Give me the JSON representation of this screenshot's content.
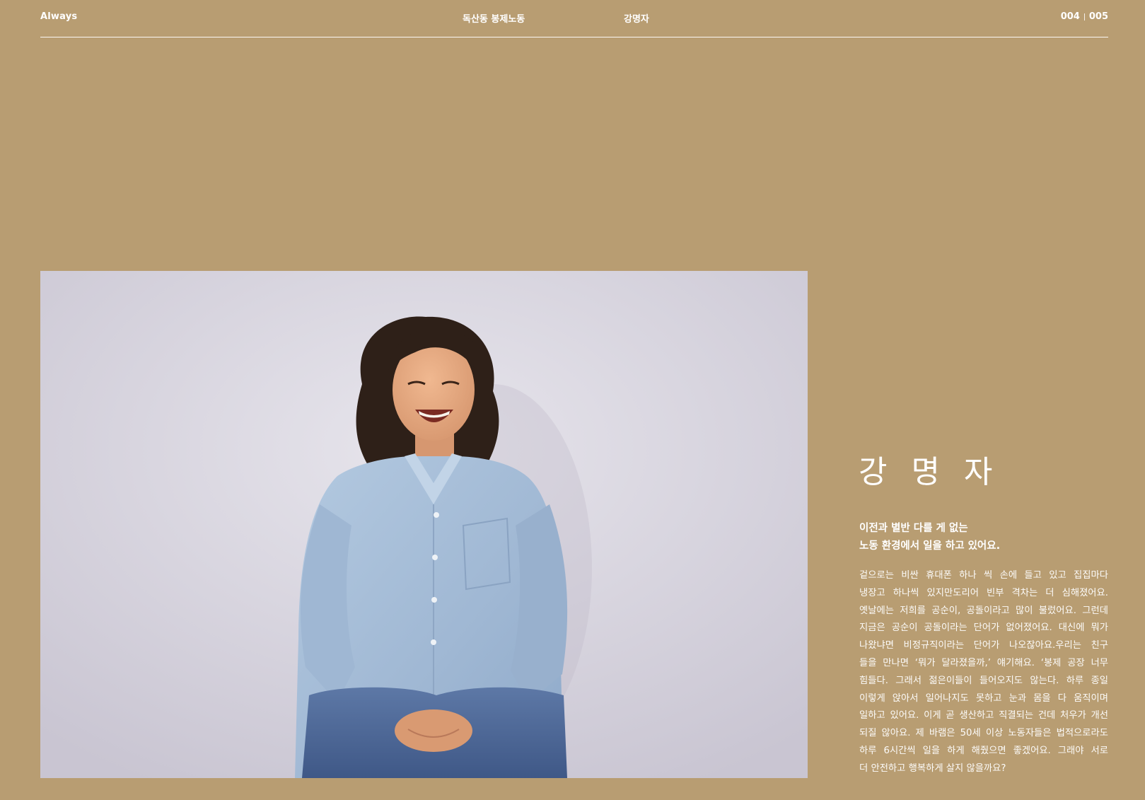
{
  "header": {
    "brand": "Always",
    "section": "독산동 봉제노동",
    "person": "강명자",
    "page_current": "004",
    "page_total": "005"
  },
  "photo": {
    "subject": "강명자 portrait"
  },
  "profile": {
    "name": "강 명 자",
    "lead_lines": [
      "이전과 별반 다를 게 없는",
      "노동 환경에서 일을 하고 있어요."
    ],
    "body_lines": [
      "겉으로는 비싼 휴대폰 하나 씩 손에 들고 있고 집집마다",
      "냉장고 하나씩 있지만도리어 빈부 격차는 더 심해졌어요.",
      "옛날에는 저희를 공순이, 공돌이라고 많이 불렀어요. 그런데",
      "지금은 공순이 공돌이라는 단어가 없어졌어요. 대신에 뭐가",
      "나왔냐면 비정규직이라는 단어가 나오잖아요.우리는 친구",
      "들을 만나면 ‘뭐가 달라졌을까,’ 얘기해요. ‘봉제 공장 너무",
      "힘들다. 그래서 젊은이들이 들어오지도 않는다. 하루 종일",
      "이렇게 앉아서 일어나지도 못하고 눈과 몸을 다 움직이며",
      "일하고 있어요. 이게 곧 생산하고 직결되는 건데 처우가 개선",
      "되질 않아요. 제 바램은 50세 이상 노동자들은 법적으로라도",
      "하루 6시간씩 일을 하게 해줬으면 좋겠어요. 그래야 서로",
      "더 안전하고 행복하게 살지 않을까요?"
    ]
  },
  "colors": {
    "background": "#b89d72",
    "text": "#ffffff",
    "photo_backdrop": "#dcdae3",
    "shirt": "#a9c1db",
    "jeans": "#4f6a99"
  }
}
